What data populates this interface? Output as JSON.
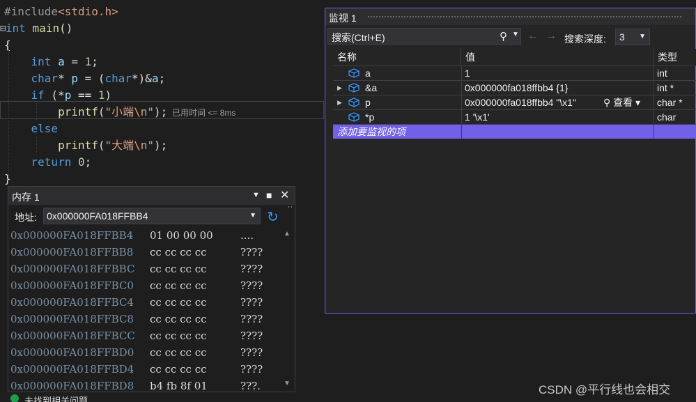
{
  "editor": {
    "top_fragment": "...",
    "lines": [
      {
        "segments": [
          {
            "cls": "pp",
            "t": "#include"
          },
          {
            "cls": "str",
            "t": "<stdio.h>"
          }
        ]
      },
      {
        "segments": [
          {
            "cls": "kw",
            "t": "int"
          },
          {
            "cls": "plain",
            "t": " "
          },
          {
            "cls": "fn",
            "t": "main"
          },
          {
            "cls": "plain",
            "t": "()"
          }
        ]
      },
      {
        "segments": [
          {
            "cls": "plain",
            "t": "{"
          }
        ]
      },
      {
        "segments": [
          {
            "cls": "plain",
            "t": "    "
          },
          {
            "cls": "kw",
            "t": "int"
          },
          {
            "cls": "plain",
            "t": " "
          },
          {
            "cls": "var",
            "t": "a"
          },
          {
            "cls": "plain",
            "t": " = "
          },
          {
            "cls": "num",
            "t": "1"
          },
          {
            "cls": "plain",
            "t": ";"
          }
        ]
      },
      {
        "segments": [
          {
            "cls": "plain",
            "t": "    "
          },
          {
            "cls": "kw",
            "t": "char"
          },
          {
            "cls": "plain",
            "t": "* "
          },
          {
            "cls": "var",
            "t": "p"
          },
          {
            "cls": "plain",
            "t": " = ("
          },
          {
            "cls": "kw",
            "t": "char"
          },
          {
            "cls": "plain",
            "t": "*)&"
          },
          {
            "cls": "var",
            "t": "a"
          },
          {
            "cls": "plain",
            "t": ";"
          }
        ]
      },
      {
        "segments": [
          {
            "cls": "plain",
            "t": "    "
          },
          {
            "cls": "kw",
            "t": "if"
          },
          {
            "cls": "plain",
            "t": " (*"
          },
          {
            "cls": "var",
            "t": "p"
          },
          {
            "cls": "plain",
            "t": " == "
          },
          {
            "cls": "num",
            "t": "1"
          },
          {
            "cls": "plain",
            "t": ")"
          }
        ]
      },
      {
        "segments": [
          {
            "cls": "plain",
            "t": "        "
          },
          {
            "cls": "fn",
            "t": "printf"
          },
          {
            "cls": "plain",
            "t": "("
          },
          {
            "cls": "str",
            "t": "\"小端\\n\""
          },
          {
            "cls": "plain",
            "t": ");"
          }
        ]
      },
      {
        "segments": [
          {
            "cls": "plain",
            "t": "    "
          },
          {
            "cls": "kw",
            "t": "else"
          }
        ]
      },
      {
        "segments": [
          {
            "cls": "plain",
            "t": "        "
          },
          {
            "cls": "fn",
            "t": "printf"
          },
          {
            "cls": "plain",
            "t": "("
          },
          {
            "cls": "str",
            "t": "\"大端\\n\""
          },
          {
            "cls": "plain",
            "t": ");"
          }
        ]
      },
      {
        "segments": [
          {
            "cls": "plain",
            "t": "    "
          },
          {
            "cls": "kw",
            "t": "return"
          },
          {
            "cls": "plain",
            "t": " "
          },
          {
            "cls": "num",
            "t": "0"
          },
          {
            "cls": "plain",
            "t": ";"
          }
        ]
      },
      {
        "segments": [
          {
            "cls": "plain",
            "t": "}"
          }
        ]
      }
    ],
    "elapsed_hint": "已用时间 <= 8ms"
  },
  "watch": {
    "title": "监视 1",
    "search_placeholder": "搜索(Ctrl+E)",
    "depth_label": "搜索深度:",
    "depth_value": "3",
    "columns": {
      "name": "名称",
      "value": "值",
      "type": "类型"
    },
    "rows": [
      {
        "name": "a",
        "value": "1",
        "type": "int",
        "expandable": false
      },
      {
        "name": "&a",
        "value": "0x000000fa018ffbb4 {1}",
        "type": "int *",
        "expandable": true
      },
      {
        "name": "p",
        "value": "0x000000fa018ffbb4 \"\\x1\"",
        "type": "char *",
        "expandable": true
      },
      {
        "name": "*p",
        "value": "1 '\\x1'",
        "type": "char",
        "expandable": false
      }
    ],
    "view_label": "查看",
    "add_item": "添加要监视的项"
  },
  "memory": {
    "title": "内存 1",
    "address_label": "地址:",
    "address_value": "0x000000FA018FFBB4",
    "rows": [
      {
        "addr": "0x000000FA018FFBB4",
        "bytes": "01 00 00 00",
        "ascii": "...."
      },
      {
        "addr": "0x000000FA018FFBB8",
        "bytes": "cc cc cc cc",
        "ascii": "????"
      },
      {
        "addr": "0x000000FA018FFBBC",
        "bytes": "cc cc cc cc",
        "ascii": "????"
      },
      {
        "addr": "0x000000FA018FFBC0",
        "bytes": "cc cc cc cc",
        "ascii": "????"
      },
      {
        "addr": "0x000000FA018FFBC4",
        "bytes": "cc cc cc cc",
        "ascii": "????"
      },
      {
        "addr": "0x000000FA018FFBC8",
        "bytes": "cc cc cc cc",
        "ascii": "????"
      },
      {
        "addr": "0x000000FA018FFBCC",
        "bytes": "cc cc cc cc",
        "ascii": "????"
      },
      {
        "addr": "0x000000FA018FFBD0",
        "bytes": "cc cc cc cc",
        "ascii": "????"
      },
      {
        "addr": "0x000000FA018FFBD4",
        "bytes": "cc cc cc cc",
        "ascii": "????"
      },
      {
        "addr": "0x000000FA018FFBD8",
        "bytes": "b4 fb 8f 01",
        "ascii": "???."
      }
    ]
  },
  "status": {
    "text": "未找到相关问题"
  },
  "watermark": "CSDN @平行线也会相交",
  "colors": {
    "accent": "#7160e8",
    "background": "#1e1e1e",
    "panel": "#252526"
  }
}
